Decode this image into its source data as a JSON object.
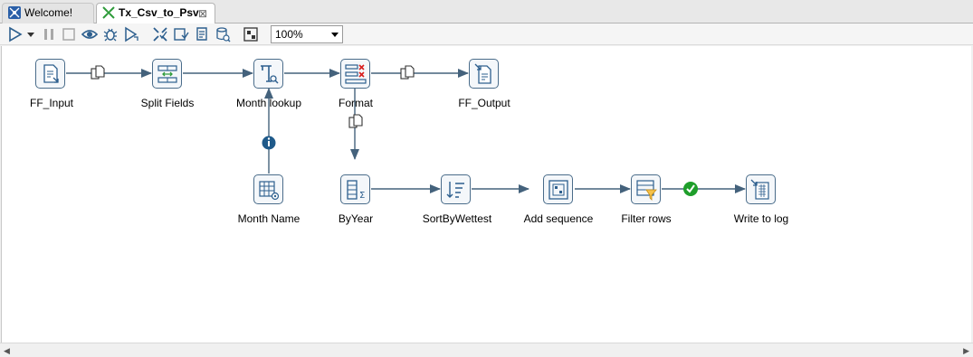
{
  "tabs": [
    {
      "label": "Welcome!",
      "icon": "welcome-icon"
    },
    {
      "label": "Tx_Csv_to_Psv",
      "icon": "transformation-icon",
      "close": "⊠"
    }
  ],
  "toolbar": {
    "zoom": "100%",
    "buttons": [
      "run-icon",
      "run-dropdown-icon",
      "pause-icon",
      "stop-icon",
      "preview-icon",
      "debug-icon",
      "replay-icon",
      "verify-icon",
      "analyze-impact-icon",
      "sql-icon",
      "explore-db-icon",
      "show-results-icon"
    ]
  },
  "steps": [
    {
      "label": "FF_Input",
      "icon": "text-file-input-icon"
    },
    {
      "label": "Split Fields",
      "icon": "split-fields-icon"
    },
    {
      "label": "Month lookup",
      "icon": "stream-lookup-icon"
    },
    {
      "label": "Format",
      "icon": "select-values-icon"
    },
    {
      "label": "FF_Output",
      "icon": "text-file-output-icon"
    },
    {
      "label": "Month Name",
      "icon": "data-grid-icon"
    },
    {
      "label": "ByYear",
      "icon": "group-by-icon"
    },
    {
      "label": "SortByWettest",
      "icon": "sort-rows-icon"
    },
    {
      "label": "Add sequence",
      "icon": "add-sequence-icon"
    },
    {
      "label": "Filter rows",
      "icon": "filter-rows-icon"
    },
    {
      "label": "Write to log",
      "icon": "write-to-log-icon"
    }
  ],
  "hops": [
    {
      "from": "FF_Input",
      "to": "Split Fields",
      "badge": "copy-rows-icon"
    },
    {
      "from": "Split Fields",
      "to": "Month lookup"
    },
    {
      "from": "Month lookup",
      "to": "Format"
    },
    {
      "from": "Format",
      "to": "FF_Output",
      "badge": "copy-rows-icon"
    },
    {
      "from": "Month Name",
      "to": "Month lookup",
      "badge": "info-icon"
    },
    {
      "from": "Format",
      "to": "ByYear",
      "badge": "copy-rows-icon"
    },
    {
      "from": "ByYear",
      "to": "SortByWettest"
    },
    {
      "from": "SortByWettest",
      "to": "Add sequence"
    },
    {
      "from": "Add sequence",
      "to": "Filter rows"
    },
    {
      "from": "Filter rows",
      "to": "Write to log",
      "badge": "true-result-icon"
    }
  ],
  "colors": {
    "hop": "#44627c",
    "step_border": "#4a6c8a",
    "info_badge": "#1f5a8a",
    "true_badge": "#1e9e2a",
    "error_mark": "#d81e1e"
  }
}
